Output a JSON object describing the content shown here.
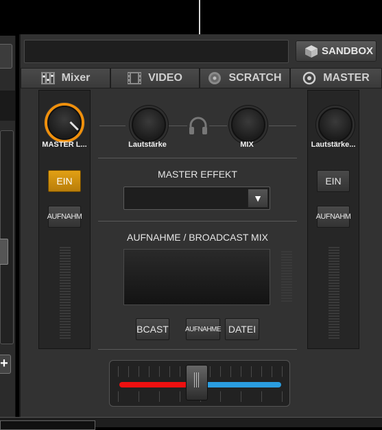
{
  "header": {
    "sandbox_label": "SANDBOX",
    "deck_name": ""
  },
  "tabs": [
    {
      "label": "Mixer",
      "icon": "mixer-icon"
    },
    {
      "label": "VIDEO",
      "icon": "film-icon"
    },
    {
      "label": "SCRATCH",
      "icon": "vinyl-icon"
    },
    {
      "label": "MASTER",
      "icon": "target-icon"
    }
  ],
  "left_channel": {
    "knob_label": "MASTER L...",
    "on_label": "EIN",
    "record_label": "AUFNAHM"
  },
  "center": {
    "volume_label": "Lautstärke",
    "mix_label": "MIX",
    "effect_title": "MASTER EFFEKT",
    "effect_value": "",
    "broadcast_title": "AUFNAHME / BROADCAST MIX",
    "bcast_label": "BCAST",
    "record_label": "AUFNAHME",
    "file_label": "DATEI"
  },
  "right_channel": {
    "knob_label": "Lautstärke...",
    "on_label": "EIN",
    "record_label": "AUFNAHM"
  },
  "colors": {
    "accent": "#f0900c",
    "crossfader_left": "#ee1010",
    "crossfader_right": "#2a9de0"
  },
  "crossfader": {
    "position": 0.48
  }
}
